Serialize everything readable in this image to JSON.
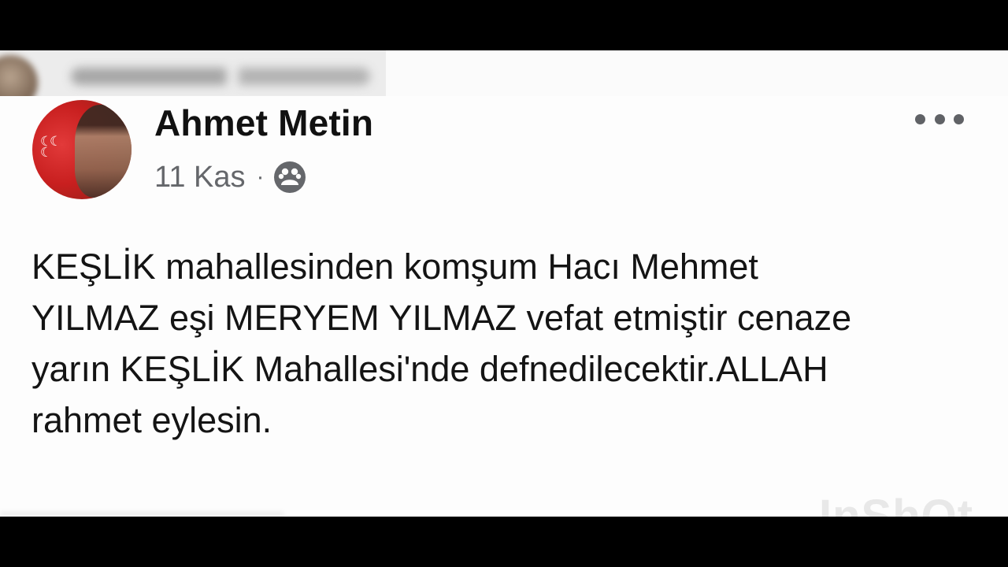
{
  "post": {
    "author": "Ahmet Metin",
    "date": "11 Kas",
    "separator": "·",
    "audience_icon": "friends-icon",
    "more_icon": "more-horizontal-icon",
    "body_lines": [
      "KEŞLİK mahallesinden komşum Hacı Mehmet",
      "YILMAZ eşi MERYEM YILMAZ vefat etmiştir cenaze",
      "yarın KEŞLİK Mahallesi'nde defnedilecektir.ALLAH",
      "rahmet eylesin."
    ]
  },
  "watermark": {
    "text": "InShOt"
  },
  "colors": {
    "letterbox": "#000000",
    "card_background": "#fdfdfd",
    "author_text": "#111111",
    "meta_text": "#65676b",
    "body_text": "#141414",
    "avatar_red": "#c81f1f"
  }
}
